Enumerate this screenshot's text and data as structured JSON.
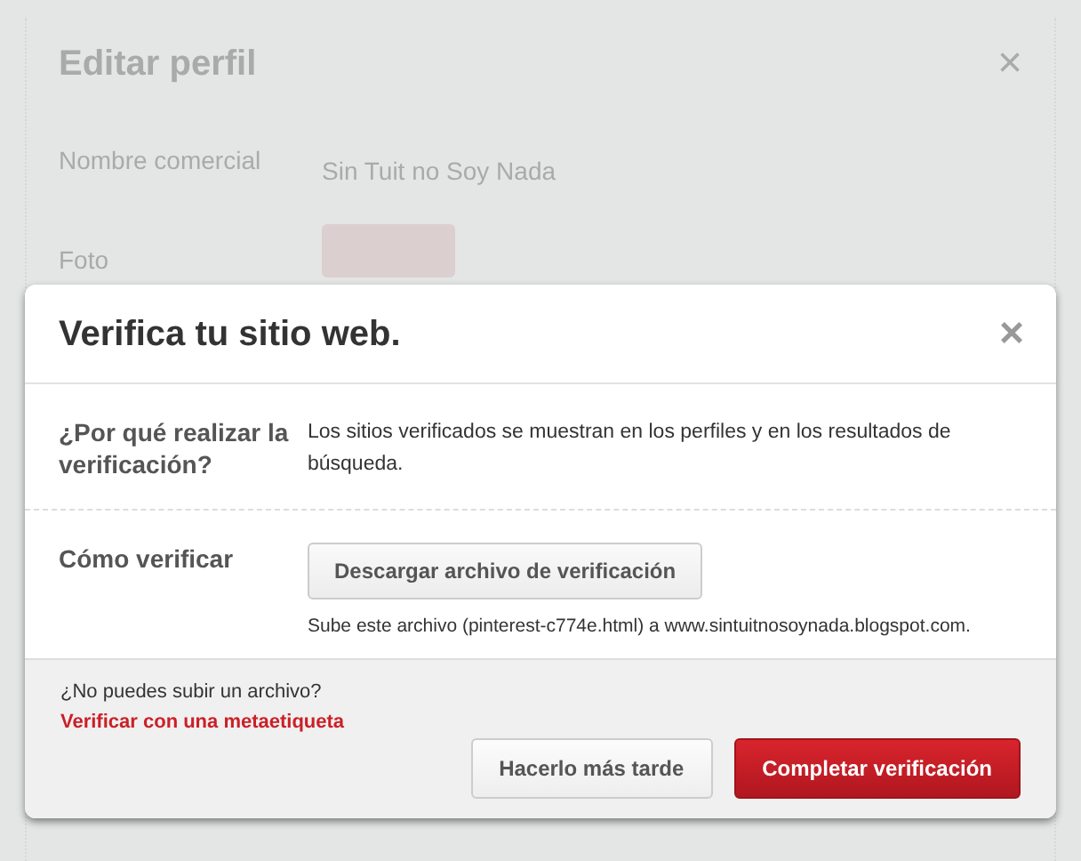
{
  "background_dialog": {
    "title": "Editar perfil",
    "close": "×",
    "fields": [
      {
        "label": "Nombre comercial",
        "value": "Sin Tuit no Soy Nada",
        "kind": "text"
      },
      {
        "label": "Foto",
        "kind": "photo"
      }
    ]
  },
  "modal": {
    "title": "Verifica tu sitio web.",
    "close": "×",
    "rows": [
      {
        "label": "¿Por qué realizar la verificación?",
        "kind": "text",
        "text": "Los sitios verificados se muestran en los perfiles y en los resultados de búsqueda."
      },
      {
        "label": "Cómo verificar",
        "kind": "action",
        "button": "Descargar archivo de verificación",
        "note": "Sube este archivo (pinterest-c774e.html) a www.sintuitnosoynada.blogspot.com."
      }
    ],
    "footer": {
      "prompt": "¿No puedes subir un archivo?",
      "link": "Verificar con una metaetiqueta",
      "buttons": [
        {
          "label": "Hacerlo más tarde",
          "kind": "secondary"
        },
        {
          "label": "Completar verificación",
          "kind": "primary"
        }
      ]
    }
  }
}
